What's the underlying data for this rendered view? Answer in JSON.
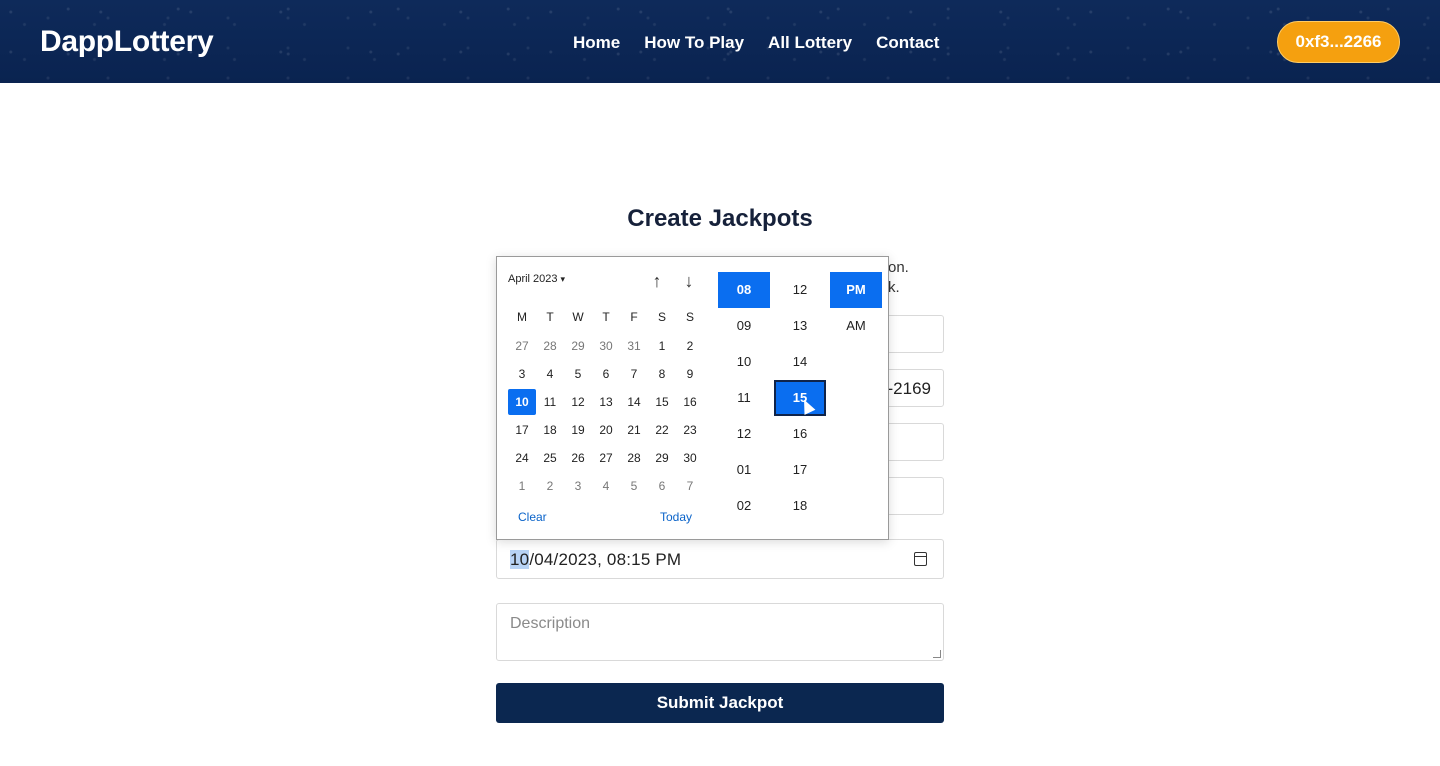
{
  "header": {
    "logo": "DappLottery",
    "nav": [
      "Home",
      "How To Play",
      "All Lottery",
      "Contact"
    ],
    "wallet": "0xf3...2266"
  },
  "main": {
    "title": "Create Jackpots",
    "intro_line1": "on.",
    "intro_line2": "k.",
    "field_value_partial": "-2169",
    "date_value_prefix": "10",
    "date_value_rest": "/04/2023, 08:15 PM",
    "description_placeholder": "Description",
    "submit_label": "Submit Jackpot"
  },
  "picker": {
    "month_label": "April 2023",
    "weekdays": [
      "M",
      "T",
      "W",
      "T",
      "F",
      "S",
      "S"
    ],
    "weeks": [
      [
        "27",
        "28",
        "29",
        "30",
        "31",
        "1",
        "2"
      ],
      [
        "3",
        "4",
        "5",
        "6",
        "7",
        "8",
        "9"
      ],
      [
        "10",
        "11",
        "12",
        "13",
        "14",
        "15",
        "16"
      ],
      [
        "17",
        "18",
        "19",
        "20",
        "21",
        "22",
        "23"
      ],
      [
        "24",
        "25",
        "26",
        "27",
        "28",
        "29",
        "30"
      ],
      [
        "1",
        "2",
        "3",
        "4",
        "5",
        "6",
        "7"
      ]
    ],
    "clear_label": "Clear",
    "today_label": "Today",
    "hours": [
      "08",
      "09",
      "10",
      "11",
      "12",
      "01",
      "02"
    ],
    "minutes": [
      "12",
      "13",
      "14",
      "15",
      "16",
      "17",
      "18"
    ],
    "ampm": [
      "PM",
      "AM"
    ],
    "selected_day": "10",
    "selected_hour": "08",
    "selected_minute": "15",
    "selected_ampm": "PM"
  },
  "colors": {
    "accent": "#0a6ef0",
    "header_bg": "#0a2350",
    "wallet_bg": "#f5a00f",
    "submit_bg": "#0b2750"
  }
}
